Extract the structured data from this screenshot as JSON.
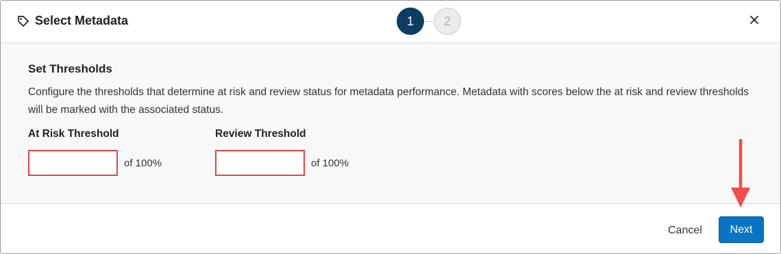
{
  "dialog": {
    "title": "Select Metadata",
    "icon": "tag-icon",
    "close_icon": "close-icon"
  },
  "stepper": {
    "steps": [
      {
        "label": "1",
        "state": "active"
      },
      {
        "label": "2",
        "state": "inactive"
      }
    ]
  },
  "body": {
    "section_title": "Set Thresholds",
    "description": "Configure the thresholds that determine at risk and review status for metadata performance. Metadata with scores below the at risk and review thresholds will be marked with the associated status.",
    "fields": [
      {
        "label": "At Risk Threshold",
        "value": "",
        "suffix": "of 100%"
      },
      {
        "label": "Review Threshold",
        "value": "",
        "suffix": "of 100%"
      }
    ]
  },
  "footer": {
    "cancel_label": "Cancel",
    "next_label": "Next"
  },
  "colors": {
    "step_active": "#0c3d63",
    "primary_button": "#0a74c4",
    "highlight_border": "#e04545",
    "annotation_arrow": "#f24b4b"
  }
}
